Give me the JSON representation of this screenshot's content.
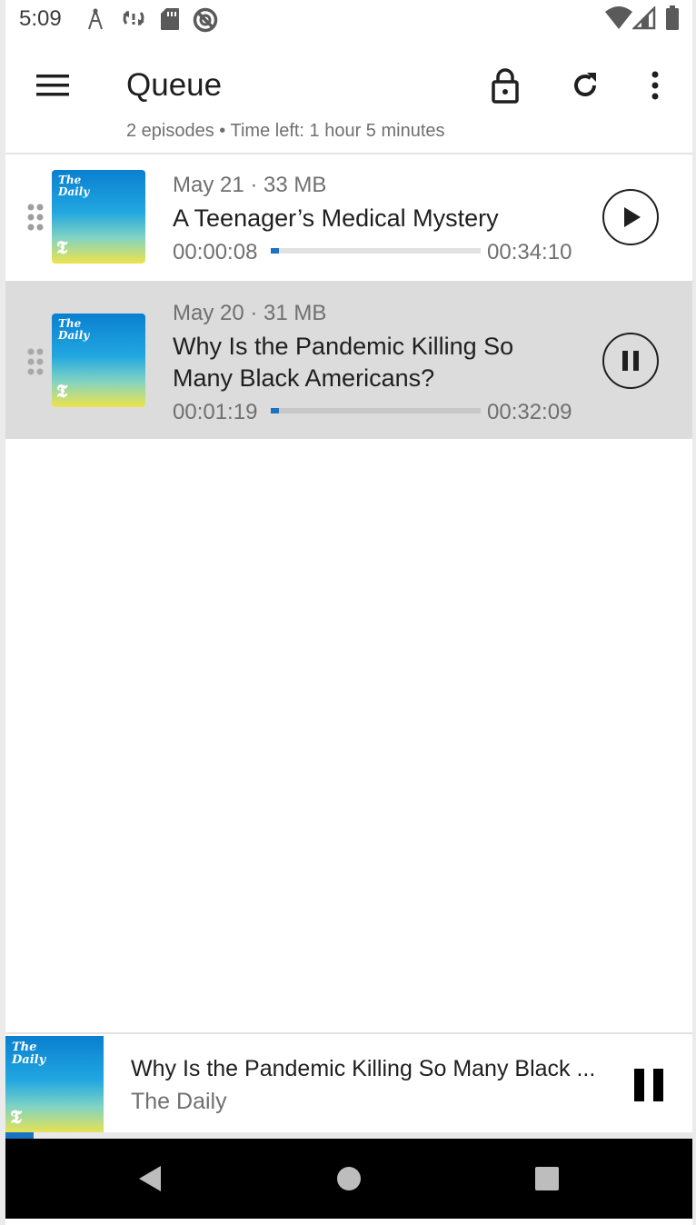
{
  "status_bar": {
    "time": "5:09",
    "left_icons": [
      "antenna-icon",
      "sync-icon",
      "sd-card-icon",
      "blocked-icon"
    ],
    "right_icons": [
      "wifi-icon",
      "signal-icon",
      "battery-icon"
    ]
  },
  "toolbar": {
    "title": "Queue",
    "subtitle": "2 episodes • Time left: 1 hour 5 minutes",
    "icons": [
      "menu-icon",
      "lock-icon",
      "refresh-icon",
      "more-vert-icon"
    ]
  },
  "episodes": [
    {
      "meta": "May 21 · 33 MB",
      "title": "A Teenager’s Medical Mystery",
      "elapsed": "00:00:08",
      "duration": "00:34:10",
      "progress": 0.004,
      "action": "play-icon",
      "active": false,
      "cover_text": "The\nDaily"
    },
    {
      "meta": "May 20 · 31 MB",
      "title": "Why Is the Pandemic Killing So Many Black Americans?",
      "elapsed": "00:01:19",
      "duration": "00:32:09",
      "progress": 0.041,
      "action": "pause-icon",
      "active": true,
      "cover_text": "The\nDaily"
    }
  ],
  "player": {
    "title": "Why Is the Pandemic Killing So Many Black ...",
    "podcast": "The Daily",
    "cover_text": "The\nDaily",
    "progress": 0.041,
    "action": "pause-icon"
  },
  "nav": [
    "back-icon",
    "home-icon",
    "recents-icon"
  ],
  "colors": {
    "accent": "#1a73c2",
    "active_row": "#dcdcdc",
    "text_primary": "#1f1f1f",
    "text_secondary": "#707070"
  }
}
